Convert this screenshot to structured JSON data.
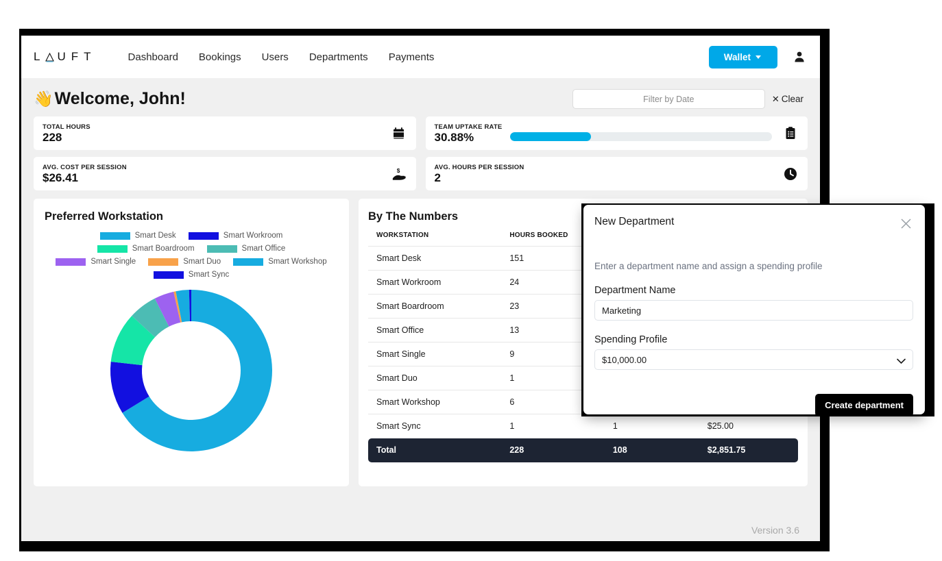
{
  "nav": {
    "logo": "L △ U F T",
    "logo_letters": [
      "L",
      "U",
      "F",
      "T"
    ],
    "links": [
      "Dashboard",
      "Bookings",
      "Users",
      "Departments",
      "Payments"
    ],
    "wallet_label": "Wallet",
    "account_icon": "user-icon"
  },
  "header": {
    "welcome": "Welcome, John!",
    "wave_emoji": "👋",
    "date_placeholder": "Filter by Date",
    "date_value": "",
    "clear_label": "Clear"
  },
  "stats": [
    {
      "label": "TOTAL HOURS",
      "value": "228",
      "icon": "calendar-icon",
      "progress": null
    },
    {
      "label": "TEAM UPTAKE RATE",
      "value": "30.88%",
      "icon": "clipboard-icon",
      "progress": 30.88
    },
    {
      "label": "AVG. COST PER SESSION",
      "value": "$26.41",
      "icon": "hand-dollar-icon",
      "progress": null
    },
    {
      "label": "AVG. HOURS PER SESSION",
      "value": "2",
      "icon": "clock-icon",
      "progress": null
    }
  ],
  "chart_panel": {
    "title": "Preferred Workstation"
  },
  "table_panel": {
    "title": "By The Numbers",
    "columns": [
      "WORKSTATION",
      "HOURS BOOKED",
      "",
      ""
    ],
    "rows": [
      {
        "workstation": "Smart Desk",
        "hours": "151",
        "sessions": "",
        "cost": ""
      },
      {
        "workstation": "Smart Workroom",
        "hours": "24",
        "sessions": "",
        "cost": ""
      },
      {
        "workstation": "Smart Boardroom",
        "hours": "23",
        "sessions": "",
        "cost": ""
      },
      {
        "workstation": "Smart Office",
        "hours": "13",
        "sessions": "",
        "cost": ""
      },
      {
        "workstation": "Smart Single",
        "hours": "9",
        "sessions": "",
        "cost": ""
      },
      {
        "workstation": "Smart Duo",
        "hours": "1",
        "sessions": "",
        "cost": ""
      },
      {
        "workstation": "Smart Workshop",
        "hours": "6",
        "sessions": "",
        "cost": ""
      },
      {
        "workstation": "Smart Sync",
        "hours": "1",
        "sessions": "1",
        "cost": "$25.00"
      }
    ],
    "total": {
      "workstation": "Total",
      "hours": "228",
      "sessions": "108",
      "cost": "$2,851.75"
    }
  },
  "modal": {
    "title": "New Department",
    "close_icon": "close-icon",
    "subtitle": "Enter a department name and assign a spending profile",
    "name_label": "Department Name",
    "name_value": "Marketing",
    "profile_label": "Spending Profile",
    "profile_value": "$10,000.00",
    "profile_options": [
      "$10,000.00"
    ],
    "submit_label": "Create department"
  },
  "footer": {
    "version": "Version 3.6"
  },
  "colors": {
    "accent": "#00a8e8",
    "progress": "#00b0e6",
    "total_row": "#1d2433",
    "page_bg": "#f0f0f0"
  },
  "chart_data": {
    "type": "pie",
    "variant": "donut",
    "title": "Preferred Workstation",
    "legend_position": "top",
    "categories": [
      "Smart Desk",
      "Smart Workroom",
      "Smart Boardroom",
      "Smart Office",
      "Smart Single",
      "Smart Duo",
      "Smart Workshop",
      "Smart Sync"
    ],
    "values": [
      151,
      24,
      23,
      13,
      9,
      1,
      6,
      1
    ],
    "unit": "hours booked",
    "total": 228,
    "colors": [
      "#17ace0",
      "#1210e0",
      "#15e5a7",
      "#4cbcb4",
      "#9d62f0",
      "#f8a24a",
      "#17ace0",
      "#1210e0"
    ]
  }
}
